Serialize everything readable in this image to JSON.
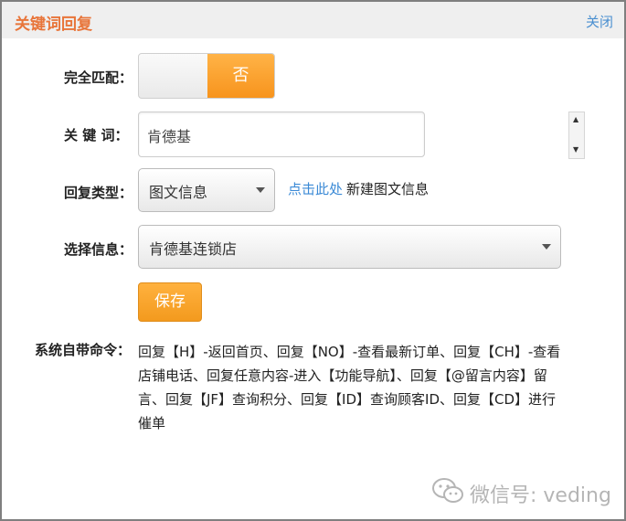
{
  "dialog": {
    "title": "关键词回复",
    "close_label": "关闭"
  },
  "form": {
    "exact_match": {
      "label": "完全匹配：",
      "off_label": "否",
      "on": false
    },
    "keyword": {
      "label": "关 键 词：",
      "value": "肯德基"
    },
    "reply_type": {
      "label": "回复类型：",
      "value": "图文信息",
      "link_text": "点击此处",
      "link_suffix": "新建图文信息"
    },
    "select_info": {
      "label": "选择信息：",
      "value": "肯德基连锁店"
    },
    "save_label": "保存"
  },
  "system_commands": {
    "label": "系统自带命令：",
    "text": "回复【H】-返回首页、回复【NO】-查看最新订单、回复【CH】-查看店铺电话、回复任意内容-进入【功能导航】、回复【@留言内容】留言、回复【JF】查询积分、回复【ID】查询顾客ID、回复【CD】进行催单"
  },
  "watermark": {
    "text": "微信号: veding",
    "icon": "wechat-icon"
  },
  "colors": {
    "accent": "#f7941d",
    "title": "#e8753a",
    "link": "#3b8ad6"
  }
}
